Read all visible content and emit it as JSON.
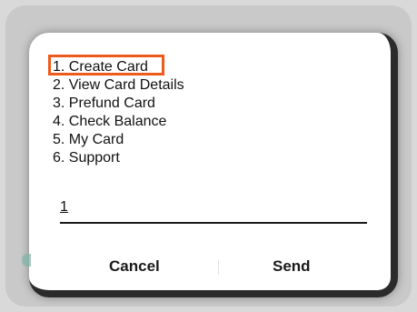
{
  "menu": {
    "items": [
      {
        "label": "1. Create Card"
      },
      {
        "label": "2. View Card Details"
      },
      {
        "label": "3. Prefund Card"
      },
      {
        "label": "4. Check Balance"
      },
      {
        "label": "5. My Card"
      },
      {
        "label": "6. Support"
      }
    ]
  },
  "input": {
    "value": "1"
  },
  "buttons": {
    "cancel": "Cancel",
    "send": "Send"
  },
  "colors": {
    "highlight": "#ee5a1c"
  }
}
